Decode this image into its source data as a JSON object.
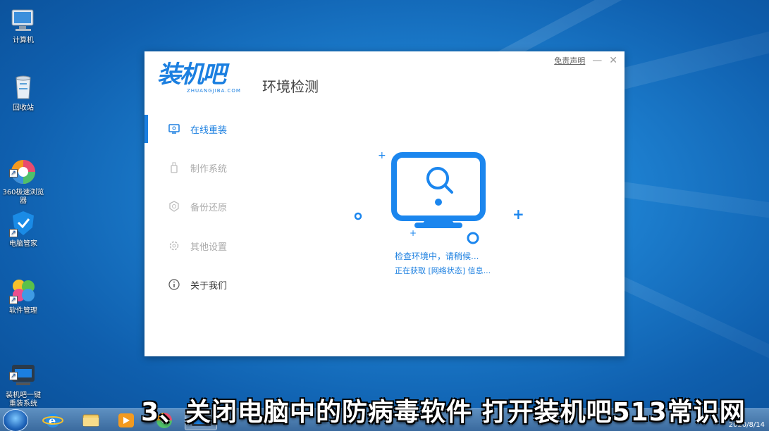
{
  "desktop": {
    "icons": [
      {
        "label": "计算机",
        "icon": "computer-icon"
      },
      {
        "label": "回收站",
        "icon": "recycle-bin-icon"
      },
      {
        "label": "360极速浏览\n器",
        "icon": "browser-360-icon"
      },
      {
        "label": "电脑管家",
        "icon": "pc-manager-icon"
      },
      {
        "label": "软件管理",
        "icon": "software-manager-icon"
      },
      {
        "label": "装机吧一键\n重装系统",
        "icon": "zhuangjiba-icon"
      }
    ]
  },
  "app": {
    "logo_text": "装机吧",
    "logo_sub": "ZHUANGJIBA.COM",
    "page_title": "环境检测",
    "disclaimer": "免责声明",
    "minimize": "—",
    "close": "✕",
    "nav": [
      {
        "label": "在线重装",
        "icon": "monitor-icon",
        "active": true
      },
      {
        "label": "制作系统",
        "icon": "usb-icon",
        "active": false
      },
      {
        "label": "备份还原",
        "icon": "backup-icon",
        "active": false
      },
      {
        "label": "其他设置",
        "icon": "gear-icon",
        "active": false
      },
      {
        "label": "关于我们",
        "icon": "info-icon",
        "active": false
      }
    ],
    "status_main": "检查环境中，请稍候...",
    "status_sub": "正在获取 [网络状态] 信息...",
    "accent": "#1b7fe0"
  },
  "taskbar": {
    "apps": [
      "ie-icon",
      "explorer-icon",
      "media-player-icon",
      "360-browser-icon",
      "zhuangjiba-taskbar-icon"
    ],
    "date": "2020/8/14"
  },
  "caption": "3、关闭电脑中的防病毒软件 打开装机吧513常识网"
}
